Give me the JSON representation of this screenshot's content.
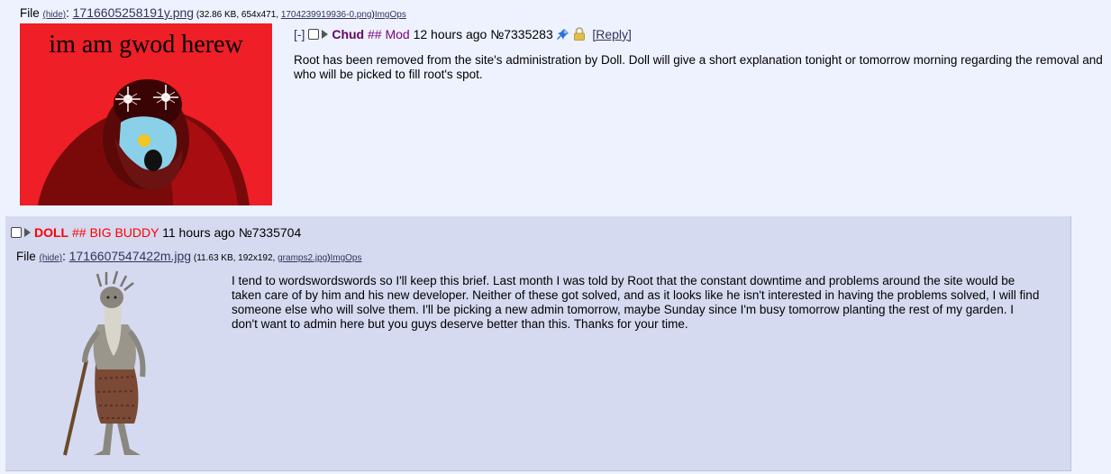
{
  "op": {
    "file_label": "File",
    "hide_label": "(hide)",
    "colon": ":",
    "filename": "1716605258191y.png",
    "file_meta_prefix": " (32.86 KB, 654x471, ",
    "orig_name": "1704239919936-0.png",
    "file_meta_suffix": ")",
    "imgops": "ImgOps",
    "image_text": "im am gwod herew",
    "collapse": "[-]",
    "name": "Chud",
    "capcode": "## Mod",
    "time": "12 hours ago",
    "post_no": "№7335283",
    "reply_link": "[Reply]",
    "body": "Root has been removed from the site's administration by Doll. Doll will give a short explanation tonight or tomorrow morning regarding the removal and who will be picked to fill root's spot."
  },
  "reply": {
    "name": "DOLL",
    "capcode": "## BIG BUDDY",
    "time": "11 hours ago",
    "post_no": "№7335704",
    "file_label": "File",
    "hide_label": "(hide)",
    "colon": ":",
    "filename": "1716607547422m.jpg",
    "file_meta_prefix": " (11.63 KB, 192x192, ",
    "orig_name": "gramps2.jpg",
    "file_meta_suffix": ")",
    "imgops": "ImgOps",
    "body": "I tend to wordswordswords so I'll keep this brief. Last month I was told by Root that the constant downtime and problems around the site would be taken care of by him and his new developer. Neither of these got solved, and as it looks like he isn't interested in having the problems solved, I will find someone else who will solve them. I'll be picking a new admin tomorrow, maybe Sunday since I'm busy tomorrow planting the rest of my garden. I don't want to admin here but you guys deserve better than this. Thanks for your time."
  },
  "colors": {
    "page_bg": "#eef2ff",
    "reply_bg": "#d6daf0",
    "link": "#34345c",
    "mod_name": "#660066",
    "admin_name": "#ff0000",
    "op_image_bg": "#ee1f26"
  }
}
